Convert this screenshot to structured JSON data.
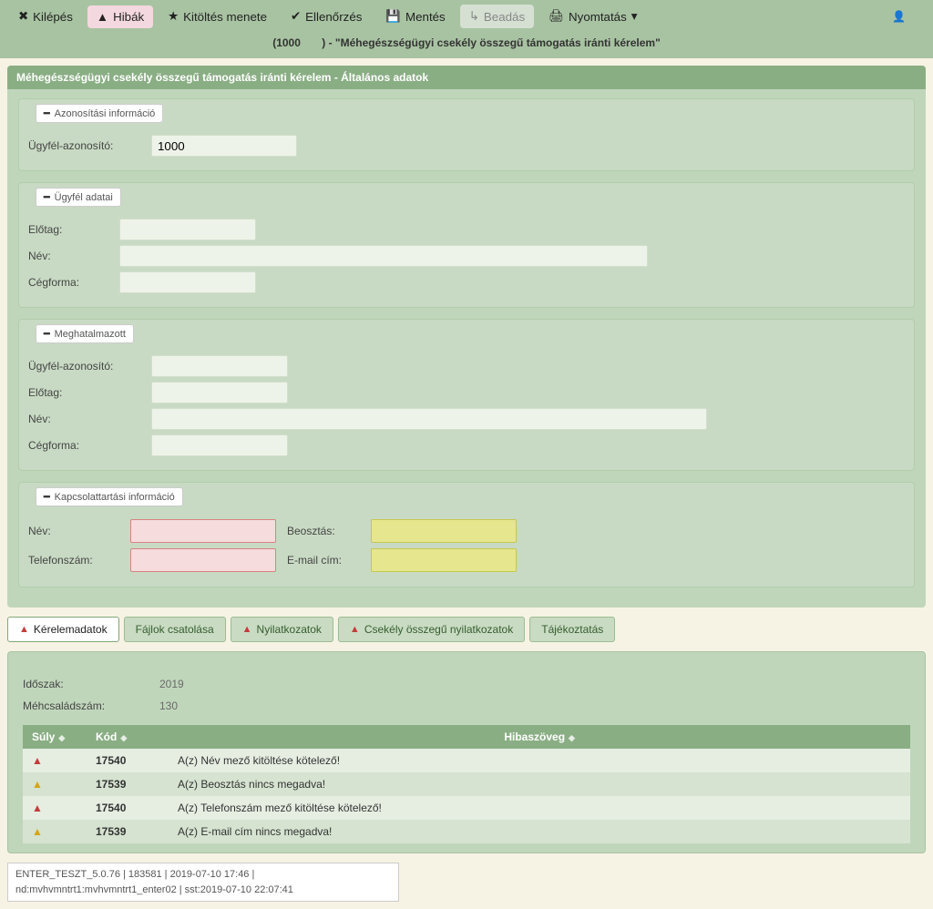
{
  "toolbar": {
    "kilepes": "Kilépés",
    "hibak": "Hibák",
    "kitoltes": "Kitöltés menete",
    "ellenorzes": "Ellenőrzés",
    "mentes": "Mentés",
    "beadas": "Beadás",
    "nyomtatas": "Nyomtatás",
    "subtitle_prefix": "(1000",
    "subtitle_suffix": ") - \"Méhegészségügyi csekély összegű támogatás iránti kérelem\""
  },
  "panel_title": "Méhegészségügyi csekély összegű támogatás iránti kérelem - Általános adatok",
  "groups": {
    "azon": {
      "legend": "Azonosítási információ",
      "ugyfel_azonosito_label": "Ügyfél-azonosító:",
      "ugyfel_azonosito_value": "1000"
    },
    "ugyfel": {
      "legend": "Ügyfél adatai",
      "elotag": "Előtag:",
      "nev": "Név:",
      "cegforma": "Cégforma:",
      "elotag_val": "",
      "nev_val": "",
      "cegforma_val": ""
    },
    "meghat": {
      "legend": "Meghatalmazott",
      "ugyfel_azonosito": "Ügyfél-azonosító:",
      "elotag": "Előtag:",
      "nev": "Név:",
      "cegforma": "Cégforma:",
      "ugyfel_azonosito_val": "",
      "elotag_val": "",
      "nev_val": "",
      "cegforma_val": ""
    },
    "kapcs": {
      "legend": "Kapcsolattartási információ",
      "nev": "Név:",
      "beosztas": "Beosztás:",
      "telefon": "Telefonszám:",
      "email": "E-mail cím:"
    }
  },
  "tabs": {
    "kerelem": "Kérelemadatok",
    "fajlok": "Fájlok csatolása",
    "nyilatk": "Nyilatkozatok",
    "csekely": "Csekély összegű nyilatkozatok",
    "tajek": "Tájékoztatás"
  },
  "details": {
    "idoszak_label": "Időszak:",
    "idoszak_value": "2019",
    "mehcsalad_label": "Méhcsaládszám:",
    "mehcsalad_value": "130"
  },
  "errtable": {
    "col_suly": "Súly",
    "col_kod": "Kód",
    "col_hibaszoveg": "Hibaszöveg",
    "rows": [
      {
        "sev": "err",
        "kod": "17540",
        "msg": "A(z) Név mező kitöltése kötelező!"
      },
      {
        "sev": "warn",
        "kod": "17539",
        "msg": "A(z) Beosztás nincs megadva!"
      },
      {
        "sev": "err",
        "kod": "17540",
        "msg": "A(z) Telefonszám mező kitöltése kötelező!"
      },
      {
        "sev": "warn",
        "kod": "17539",
        "msg": "A(z) E-mail cím nincs megadva!"
      }
    ]
  },
  "footer": {
    "line1": "ENTER_TESZT_5.0.76 | 183581 | 2019-07-10 17:46 |",
    "line2": "nd:mvhvmntrt1:mvhvmntrt1_enter02 | sst:2019-07-10 22:07:41"
  }
}
